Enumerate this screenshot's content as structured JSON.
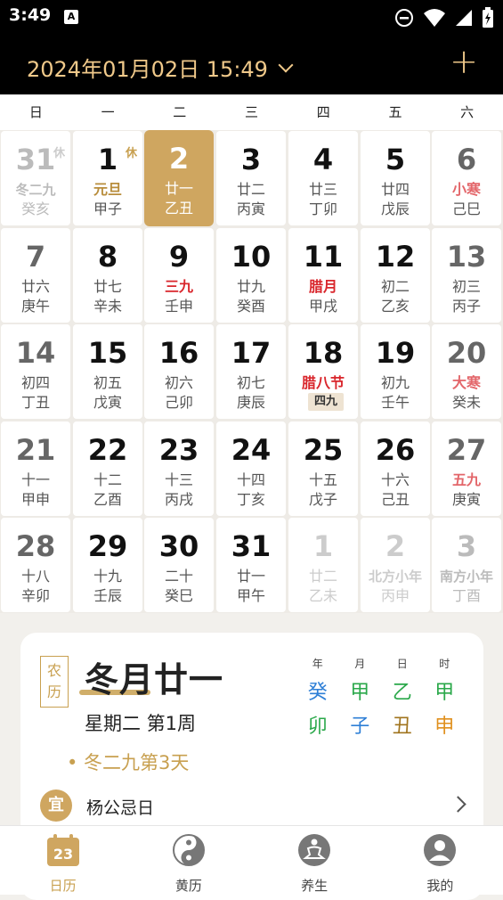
{
  "status": {
    "time": "3:49",
    "notif_letter": "A"
  },
  "header": {
    "date_label": "2024年01月02日 15:49",
    "add_symbol": "+"
  },
  "weekdays": [
    "日",
    "一",
    "二",
    "三",
    "四",
    "五",
    "六"
  ],
  "calendar": {
    "rows": [
      [
        {
          "day": "31",
          "lunar": "冬二九",
          "gz": "癸亥",
          "tag": "休",
          "style": "dim",
          "lunar_style": "fadered"
        },
        {
          "day": "1",
          "lunar": "元旦",
          "gz": "甲子",
          "tag": "休",
          "style": "normal",
          "lunar_style": "gold"
        },
        {
          "day": "2",
          "lunar": "廿一",
          "gz": "乙丑",
          "tag": "",
          "style": "selected",
          "lunar_style": ""
        },
        {
          "day": "3",
          "lunar": "廿二",
          "gz": "丙寅",
          "tag": "",
          "style": "normal",
          "lunar_style": ""
        },
        {
          "day": "4",
          "lunar": "廿三",
          "gz": "丁卯",
          "tag": "",
          "style": "normal",
          "lunar_style": ""
        },
        {
          "day": "5",
          "lunar": "廿四",
          "gz": "戊辰",
          "tag": "",
          "style": "normal",
          "lunar_style": ""
        },
        {
          "day": "6",
          "lunar": "小寒",
          "gz": "己巳",
          "tag": "",
          "style": "weekend",
          "lunar_style": "pinkred"
        }
      ],
      [
        {
          "day": "7",
          "lunar": "廿六",
          "gz": "庚午",
          "tag": "",
          "style": "weekend",
          "lunar_style": ""
        },
        {
          "day": "8",
          "lunar": "廿七",
          "gz": "辛未",
          "tag": "",
          "style": "normal",
          "lunar_style": ""
        },
        {
          "day": "9",
          "lunar": "三九",
          "gz": "壬申",
          "tag": "",
          "style": "normal",
          "lunar_style": "red"
        },
        {
          "day": "10",
          "lunar": "廿九",
          "gz": "癸酉",
          "tag": "",
          "style": "normal",
          "lunar_style": ""
        },
        {
          "day": "11",
          "lunar": "腊月",
          "gz": "甲戌",
          "tag": "",
          "style": "normal",
          "lunar_style": "red"
        },
        {
          "day": "12",
          "lunar": "初二",
          "gz": "乙亥",
          "tag": "",
          "style": "normal",
          "lunar_style": ""
        },
        {
          "day": "13",
          "lunar": "初三",
          "gz": "丙子",
          "tag": "",
          "style": "weekend",
          "lunar_style": ""
        }
      ],
      [
        {
          "day": "14",
          "lunar": "初四",
          "gz": "丁丑",
          "tag": "",
          "style": "weekend",
          "lunar_style": ""
        },
        {
          "day": "15",
          "lunar": "初五",
          "gz": "戊寅",
          "tag": "",
          "style": "normal",
          "lunar_style": ""
        },
        {
          "day": "16",
          "lunar": "初六",
          "gz": "己卯",
          "tag": "",
          "style": "normal",
          "lunar_style": ""
        },
        {
          "day": "17",
          "lunar": "初七",
          "gz": "庚辰",
          "tag": "",
          "style": "normal",
          "lunar_style": ""
        },
        {
          "day": "18",
          "lunar": "腊八节",
          "gz": "",
          "badge": "四九",
          "tag": "",
          "style": "normal",
          "lunar_style": "red"
        },
        {
          "day": "19",
          "lunar": "初九",
          "gz": "壬午",
          "tag": "",
          "style": "normal",
          "lunar_style": ""
        },
        {
          "day": "20",
          "lunar": "大寒",
          "gz": "癸未",
          "tag": "",
          "style": "weekend",
          "lunar_style": "pinkred"
        }
      ],
      [
        {
          "day": "21",
          "lunar": "十一",
          "gz": "甲申",
          "tag": "",
          "style": "weekend",
          "lunar_style": ""
        },
        {
          "day": "22",
          "lunar": "十二",
          "gz": "乙酉",
          "tag": "",
          "style": "normal",
          "lunar_style": ""
        },
        {
          "day": "23",
          "lunar": "十三",
          "gz": "丙戌",
          "tag": "",
          "style": "normal",
          "lunar_style": ""
        },
        {
          "day": "24",
          "lunar": "十四",
          "gz": "丁亥",
          "tag": "",
          "style": "normal",
          "lunar_style": ""
        },
        {
          "day": "25",
          "lunar": "十五",
          "gz": "戊子",
          "tag": "",
          "style": "normal",
          "lunar_style": ""
        },
        {
          "day": "26",
          "lunar": "十六",
          "gz": "己丑",
          "tag": "",
          "style": "normal",
          "lunar_style": ""
        },
        {
          "day": "27",
          "lunar": "五九",
          "gz": "庚寅",
          "tag": "",
          "style": "weekend",
          "lunar_style": "pinkred"
        }
      ],
      [
        {
          "day": "28",
          "lunar": "十八",
          "gz": "辛卯",
          "tag": "",
          "style": "weekend",
          "lunar_style": ""
        },
        {
          "day": "29",
          "lunar": "十九",
          "gz": "壬辰",
          "tag": "",
          "style": "normal",
          "lunar_style": ""
        },
        {
          "day": "30",
          "lunar": "二十",
          "gz": "癸巳",
          "tag": "",
          "style": "normal",
          "lunar_style": ""
        },
        {
          "day": "31",
          "lunar": "廿一",
          "gz": "甲午",
          "tag": "",
          "style": "normal",
          "lunar_style": ""
        },
        {
          "day": "1",
          "lunar": "廿二",
          "gz": "乙未",
          "tag": "",
          "style": "dim",
          "lunar_style": ""
        },
        {
          "day": "2",
          "lunar": "北方小年",
          "gz": "丙申",
          "tag": "",
          "style": "dim",
          "lunar_style": "fadered"
        },
        {
          "day": "3",
          "lunar": "南方小年",
          "gz": "丁酉",
          "tag": "",
          "style": "dim",
          "lunar_style": "fadered"
        }
      ]
    ]
  },
  "detail": {
    "seal_top": "农",
    "seal_bottom": "历",
    "lunar_date": "冬月廿一",
    "week_info": "星期二 第1周",
    "solar_term": "• 冬二九第3天",
    "gz_heads": [
      "年",
      "月",
      "日",
      "时"
    ],
    "gz_top": [
      {
        "char": "癸",
        "color": "#2e7fd6"
      },
      {
        "char": "甲",
        "color": "#2aa84a"
      },
      {
        "char": "乙",
        "color": "#2aa84a"
      },
      {
        "char": "甲",
        "color": "#2aa84a"
      }
    ],
    "gz_bottom": [
      {
        "char": "卯",
        "color": "#2aa84a"
      },
      {
        "char": "子",
        "color": "#2e7fd6"
      },
      {
        "char": "丑",
        "color": "#a0741e"
      },
      {
        "char": "申",
        "color": "#e0901e"
      }
    ],
    "yi_label": "宜",
    "yi_text": "杨公忌日"
  },
  "nav": {
    "items": [
      {
        "label": "日历",
        "icon": "calendar-icon",
        "badge": "23"
      },
      {
        "label": "黄历",
        "icon": "yin-yang-icon"
      },
      {
        "label": "养生",
        "icon": "meditation-icon"
      },
      {
        "label": "我的",
        "icon": "profile-icon"
      }
    ]
  }
}
